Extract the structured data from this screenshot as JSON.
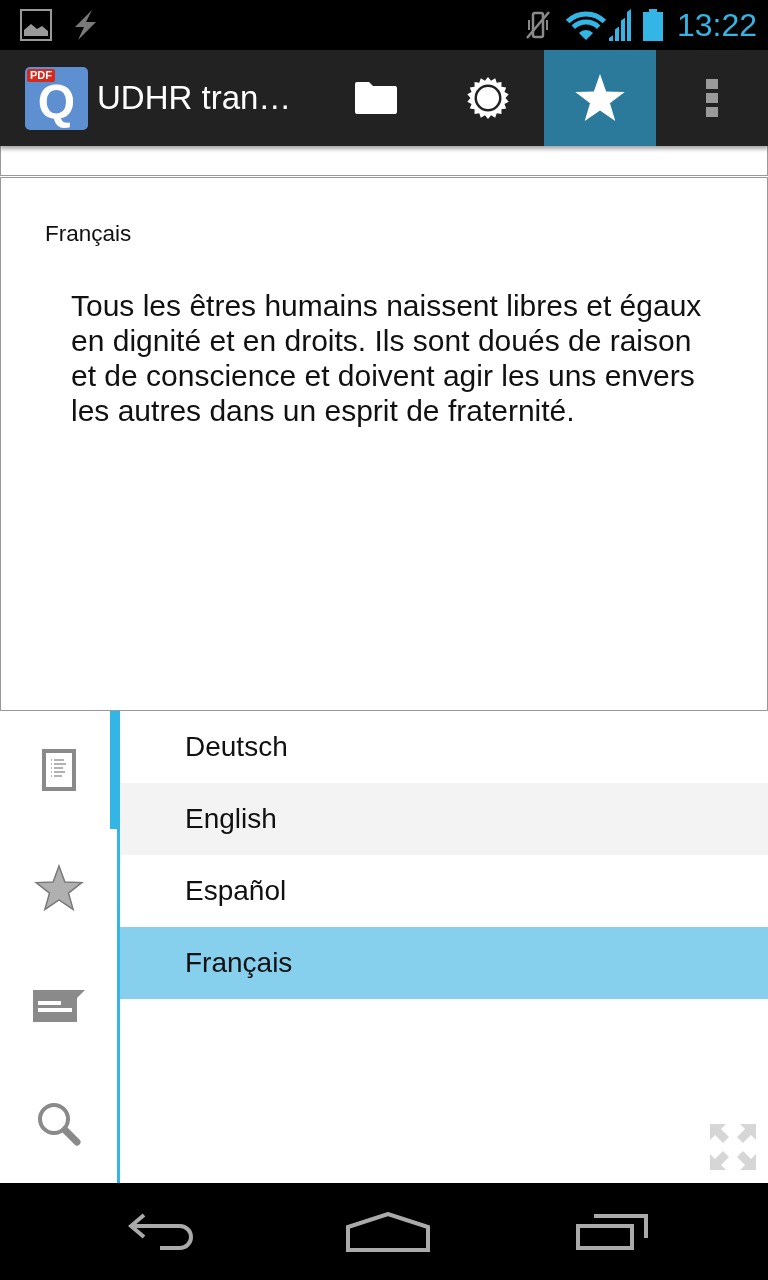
{
  "status_bar": {
    "time": "13:22"
  },
  "action_bar": {
    "app_icon": {
      "letter": "Q",
      "badge": "PDF"
    },
    "title": "UDHR tran…",
    "actions": [
      {
        "kind": "folder",
        "selected": false
      },
      {
        "kind": "brightness",
        "selected": false
      },
      {
        "kind": "star",
        "selected": true
      },
      {
        "kind": "more",
        "selected": false
      }
    ]
  },
  "document": {
    "language": "Français",
    "text": "Tous les êtres humains naissent libres et égaux en dignité et en droits. Ils sont doués de raison et de conscience et doivent agir les uns envers les autres dans un esprit de fraternité."
  },
  "side_tabs": [
    {
      "kind": "document",
      "selected": true
    },
    {
      "kind": "star",
      "selected": false
    },
    {
      "kind": "comment",
      "selected": false
    },
    {
      "kind": "search",
      "selected": false
    }
  ],
  "languages": [
    {
      "label": "Deutsch",
      "selected": false,
      "focused": false
    },
    {
      "label": "English",
      "selected": false,
      "focused": true
    },
    {
      "label": "Español",
      "selected": false,
      "focused": false
    },
    {
      "label": "Français",
      "selected": true,
      "focused": false
    }
  ]
}
